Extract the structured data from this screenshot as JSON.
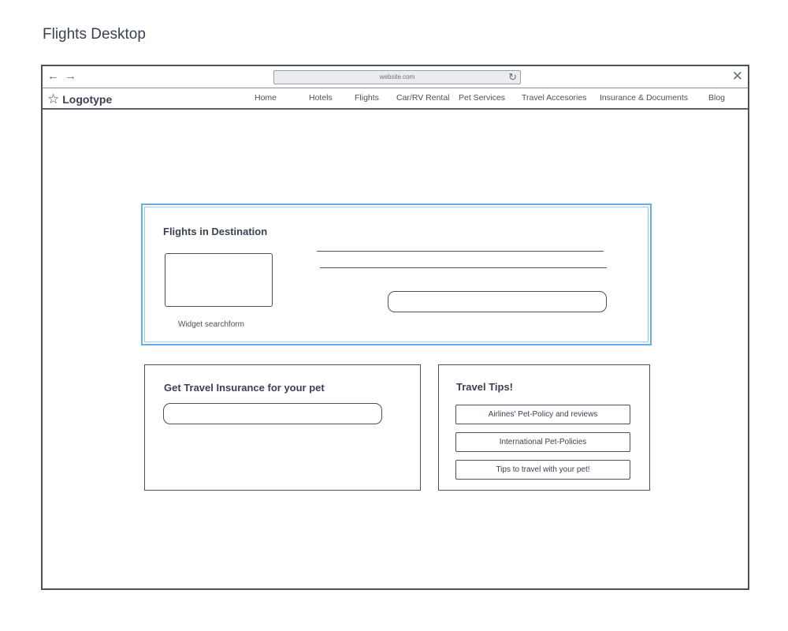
{
  "page_label": "Flights Desktop",
  "browser": {
    "back_icon": "←",
    "forward_icon": "→",
    "url": "website.com",
    "reload_icon": "↻",
    "close_icon": "✕"
  },
  "site_nav": {
    "logo_icon": "☆",
    "logo_text": "Logotype",
    "items": [
      {
        "label": "Home"
      },
      {
        "label": "Hotels"
      },
      {
        "label": "Flights"
      },
      {
        "label": "Car/RV Rental"
      },
      {
        "label": "Pet Services"
      },
      {
        "label": "Travel Accesories"
      },
      {
        "label": "Insurance & Documents"
      },
      {
        "label": "Blog"
      }
    ]
  },
  "flights_card": {
    "title": "Flights in Destination",
    "widget_caption": "Widget searchform"
  },
  "insurance_card": {
    "title": "Get Travel Insurance for your pet"
  },
  "tips_card": {
    "title": "Travel Tips!",
    "items": [
      {
        "label": "Airlines' Pet-Policy and reviews"
      },
      {
        "label": "International Pet-Policies"
      },
      {
        "label": "Tips to travel with your pet!"
      }
    ]
  },
  "colors": {
    "highlight_border": "#6aaee6",
    "ink": "#4a505c"
  }
}
